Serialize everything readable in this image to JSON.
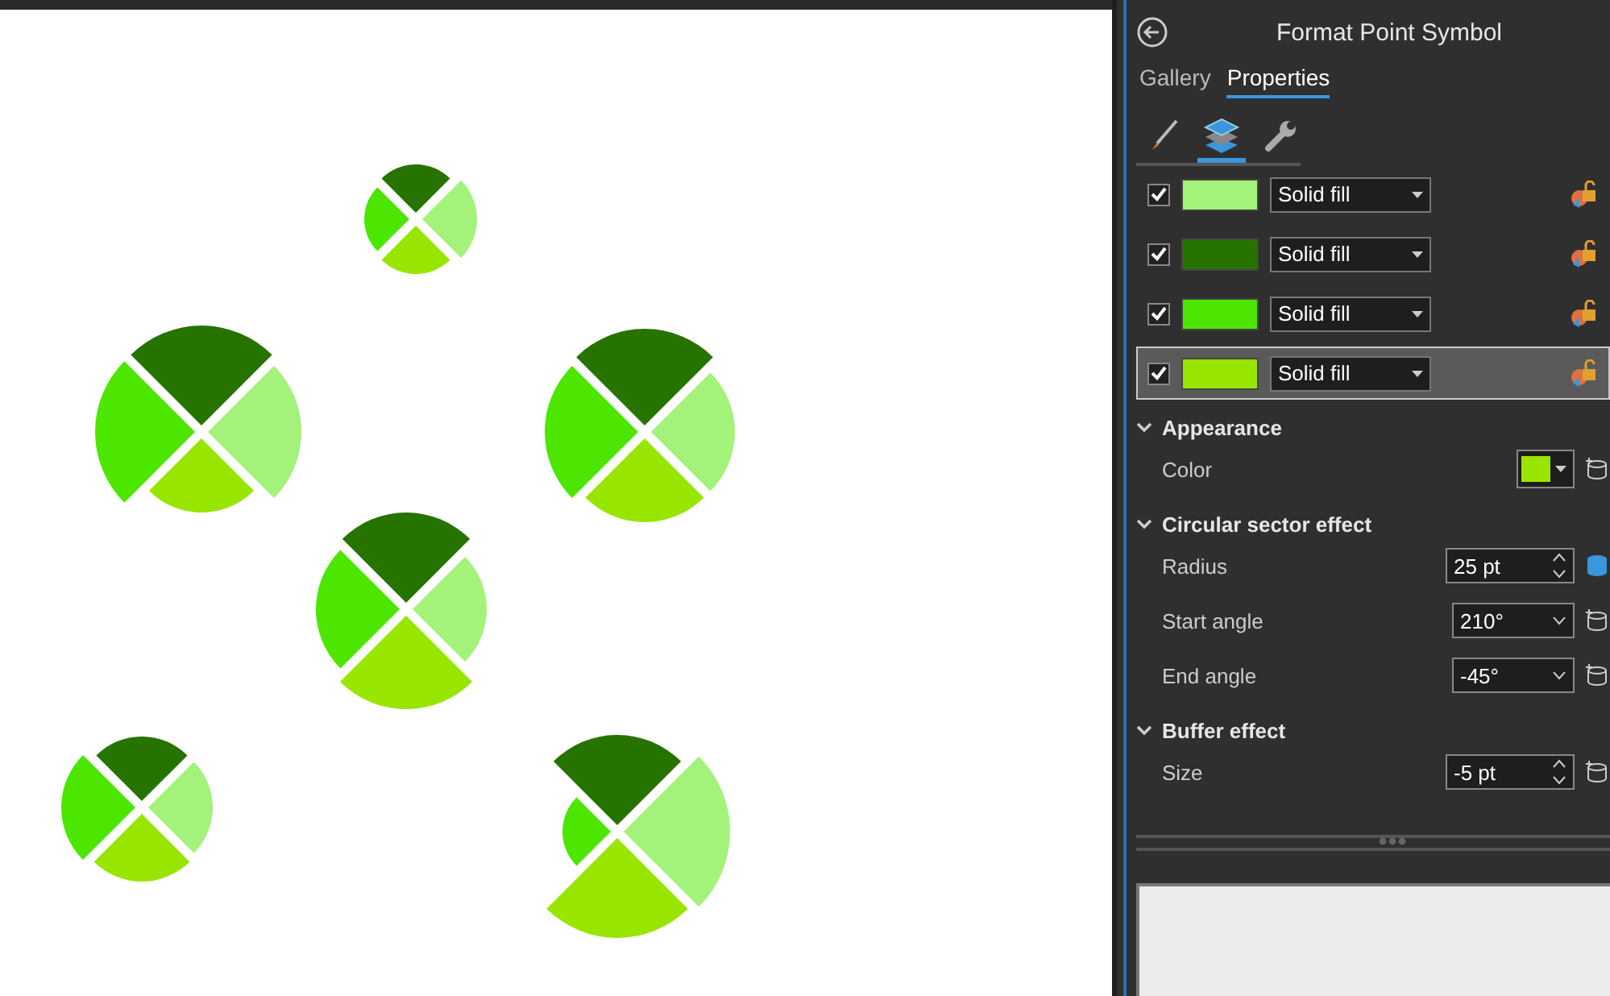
{
  "panel": {
    "title": "Format Point Symbol",
    "tabs": [
      {
        "label": "Gallery",
        "selected": false
      },
      {
        "label": "Properties",
        "selected": true
      }
    ],
    "tool_tabs": [
      {
        "kind": "brush",
        "selected": false
      },
      {
        "kind": "layers",
        "selected": true
      },
      {
        "kind": "wrench",
        "selected": false
      }
    ],
    "layers": [
      {
        "checked": true,
        "color": "#a3f27a",
        "fill": "Solid fill",
        "selected": false
      },
      {
        "checked": true,
        "color": "#267300",
        "fill": "Solid fill",
        "selected": false
      },
      {
        "checked": true,
        "color": "#4ce600",
        "fill": "Solid fill",
        "selected": false
      },
      {
        "checked": true,
        "color": "#98e600",
        "fill": "Solid fill",
        "selected": true
      }
    ],
    "sections": [
      {
        "title": "Appearance",
        "expanded": true,
        "fields": [
          {
            "kind": "color",
            "label": "Color",
            "color": "#98e600",
            "linked": false
          }
        ]
      },
      {
        "title": "Circular sector effect",
        "expanded": true,
        "fields": [
          {
            "kind": "spin",
            "label": "Radius",
            "value": "25 pt",
            "linked": true
          },
          {
            "kind": "combo",
            "label": "Start angle",
            "value": "210°",
            "linked": false
          },
          {
            "kind": "combo",
            "label": "End angle",
            "value": "-45°",
            "linked": false
          }
        ]
      },
      {
        "title": "Buffer effect",
        "expanded": true,
        "fields": [
          {
            "kind": "spin",
            "label": "Size",
            "value": "-5 pt",
            "linked": false
          }
        ]
      }
    ]
  }
}
